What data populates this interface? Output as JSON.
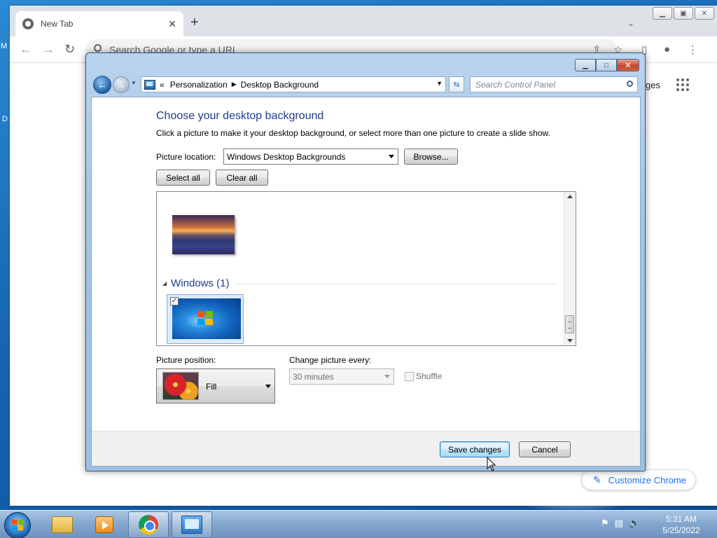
{
  "desktop": {
    "edge_letters": [
      "M",
      "D"
    ]
  },
  "chrome": {
    "tab_title": "New Tab",
    "omnibox_placeholder": "Search Google or type a URL",
    "images_link": "ges",
    "customize_label": "Customize Chrome",
    "icons": [
      "chrome-favicon-icon",
      "close-tab-icon",
      "new-tab-icon",
      "tab-search-icon",
      "back-icon",
      "forward-icon",
      "reload-icon",
      "share-icon",
      "bookmark-star-icon",
      "side-panel-icon",
      "profile-icon",
      "menu-icon",
      "apps-grid-icon",
      "pencil-icon"
    ]
  },
  "dialog": {
    "breadcrumb": [
      "Personalization",
      "Desktop Background"
    ],
    "breadcrumb_prefix": "«",
    "search_placeholder": "Search Control Panel",
    "heading": "Choose your desktop background",
    "description": "Click a picture to make it your desktop background, or select more than one picture to create a slide show.",
    "picture_location_label": "Picture location:",
    "picture_location_value": "Windows Desktop Backgrounds",
    "browse_label": "Browse...",
    "select_all_label": "Select all",
    "clear_all_label": "Clear all",
    "group_title": "Windows (1)",
    "windows_picture_checked": true,
    "picture_position_label": "Picture position:",
    "picture_position_value": "Fill",
    "change_picture_label": "Change picture every:",
    "change_picture_value": "30 minutes",
    "shuffle_label": "Shuffle",
    "save_label": "Save changes",
    "cancel_label": "Cancel"
  },
  "taskbar": {
    "time": "5:31 AM",
    "date": "5/25/2022",
    "pinned": [
      "windows-explorer",
      "media-player",
      "google-chrome",
      "control-panel"
    ],
    "active": "control-panel"
  }
}
